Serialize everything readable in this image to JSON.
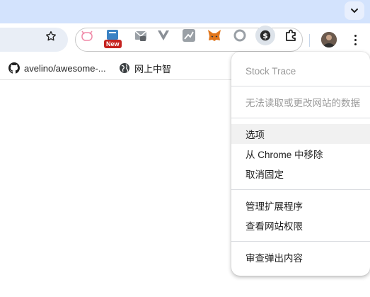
{
  "toolbar": {
    "new_badge": "New"
  },
  "extensions": [
    "cat-face-icon",
    "news-icon",
    "mail-icon",
    "vue-icon",
    "graph-icon",
    "metamask-icon",
    "circle-icon",
    "stock-trace-icon",
    "puzzle-icon"
  ],
  "bookmarks": [
    {
      "label": "avelino/awesome-...",
      "icon": "github-icon"
    },
    {
      "label": "网上中智",
      "icon": "globe-icon"
    }
  ],
  "menu": {
    "title": "Stock Trace",
    "permission_note": "无法读取或更改网站的数据",
    "options": "选项",
    "remove": "从 Chrome 中移除",
    "unpin": "取消固定",
    "manage": "管理扩展程序",
    "site_permissions": "查看网站权限",
    "inspect_popup": "审查弹出内容"
  },
  "colors": {
    "titlebar": "#d3e3fd",
    "omnibox": "#e9eef6",
    "menu_hover": "#f1f1f1",
    "badge_red": "#c5221f"
  }
}
